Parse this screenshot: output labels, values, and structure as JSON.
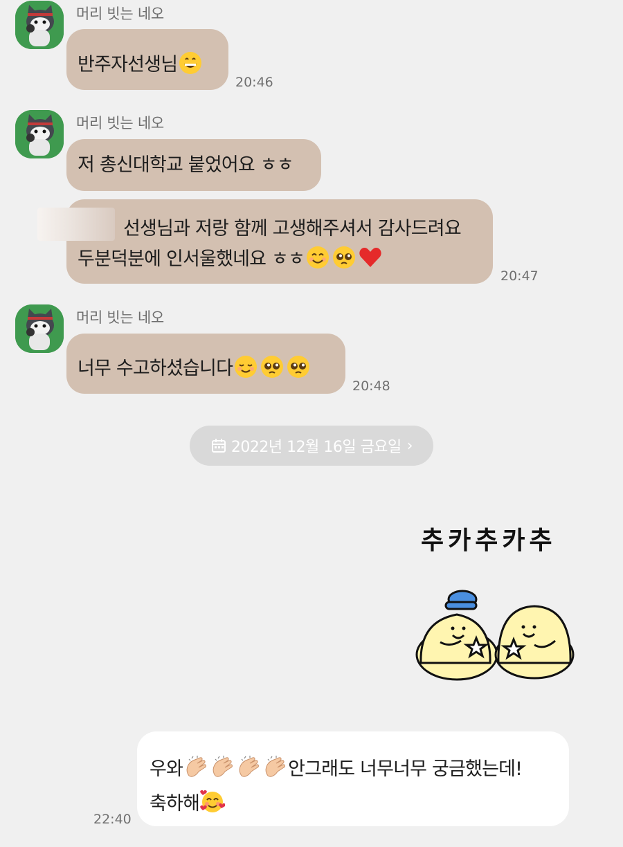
{
  "messages": [
    {
      "sender": "머리 빗는 네오",
      "text": "반주자선생님",
      "emojis": [
        "grinning-face-emoji"
      ],
      "time": "20:46"
    },
    {
      "sender": "머리 빗는 네오",
      "text": "저 총신대학교 붙었어요 ㅎㅎ"
    },
    {
      "line1": "선생님과 저랑 함께 고생해주셔서 감사드려요",
      "line2": "두분덕분에 인서울했네요 ㅎㅎ",
      "emojis": [
        "smiling-face-emoji",
        "pleading-face-emoji",
        "red-heart-emoji"
      ],
      "time": "20:47"
    },
    {
      "sender": "머리 빗는 네오",
      "text": "너무 수고하셨습니다",
      "emojis": [
        "relaxed-face-emoji",
        "pleading-face-emoji",
        "pleading-face-emoji"
      ],
      "time": "20:48"
    }
  ],
  "date_divider": {
    "label": "2022년 12월 16일 금요일",
    "icon": "calendar-icon",
    "chevron": "›"
  },
  "sticker": {
    "text": "추카추카추"
  },
  "my_message": {
    "part1": "우와",
    "part2": "안그래도 너무너무 궁금했는데!",
    "line2": "축하해",
    "emojis": [
      "clapping-hands-emoji",
      "clapping-hands-emoji",
      "clapping-hands-emoji",
      "clapping-hands-emoji",
      "smiling-face-with-hearts-emoji"
    ],
    "time": "22:40"
  },
  "colors": {
    "background": "#f0f0f0",
    "received_bubble": "#d3c0b1",
    "sent_bubble": "#ffffff",
    "avatar_bg": "#3f9a4f",
    "date_pill": "#d9d9d9"
  }
}
